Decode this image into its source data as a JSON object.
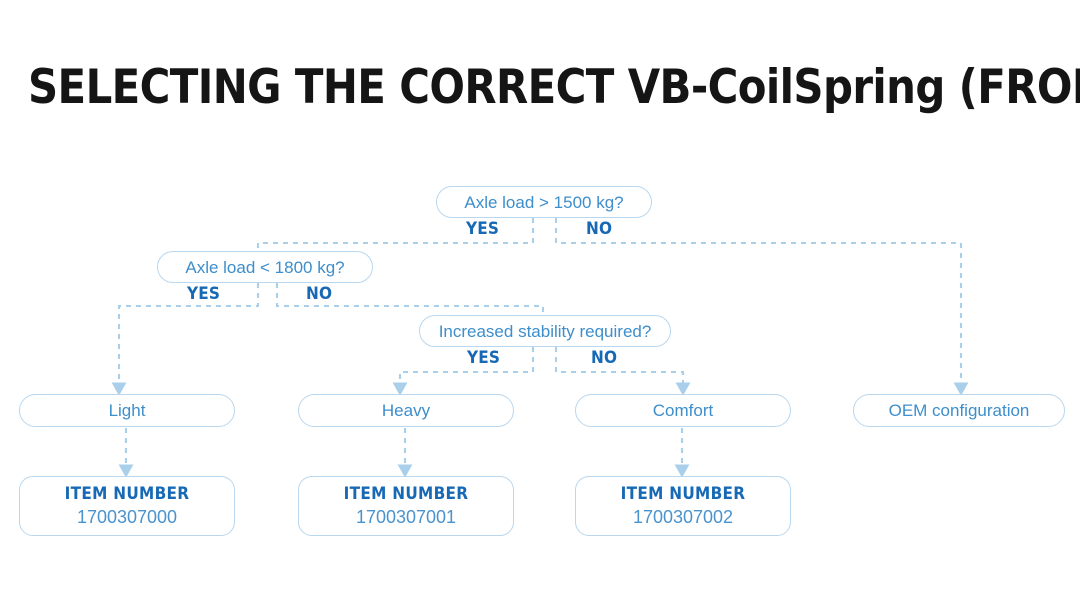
{
  "page": {
    "title": "SELECTING THE CORRECT VB-CoilSpring (FRONT AXLE)",
    "background_color": "#ffffff",
    "title_color": "#151515"
  },
  "colors": {
    "node_border": "#b9d7ee",
    "node_text": "#3d8ecb",
    "branch_label": "#1769b5",
    "connector": "#a9cfea",
    "item_value": "#4a93cd"
  },
  "flowchart": {
    "type": "decision-tree",
    "decisions": [
      {
        "id": "axle-load-1500",
        "question": "Axle load > 1500 kg?",
        "yes_label": "YES",
        "no_label": "NO",
        "yes_target": "axle-load-1800",
        "no_target": "oem-configuration"
      },
      {
        "id": "axle-load-1800",
        "question": "Axle load < 1800 kg?",
        "yes_label": "YES",
        "no_label": "NO",
        "yes_target": "light",
        "no_target": "increased-stability"
      },
      {
        "id": "increased-stability",
        "question": "Increased stability required?",
        "yes_label": "YES",
        "no_label": "NO",
        "yes_target": "heavy",
        "no_target": "comfort"
      }
    ],
    "outcomes": [
      {
        "id": "light",
        "label": "Light"
      },
      {
        "id": "heavy",
        "label": "Heavy"
      },
      {
        "id": "comfort",
        "label": "Comfort"
      },
      {
        "id": "oem-configuration",
        "label": "OEM configuration"
      }
    ],
    "results": [
      {
        "id": "item-light",
        "heading": "ITEM NUMBER",
        "value": "1700307000",
        "for_outcome": "light"
      },
      {
        "id": "item-heavy",
        "heading": "ITEM NUMBER",
        "value": "1700307001",
        "for_outcome": "heavy"
      },
      {
        "id": "item-comfort",
        "heading": "ITEM NUMBER",
        "value": "1700307002",
        "for_outcome": "comfort"
      }
    ]
  }
}
